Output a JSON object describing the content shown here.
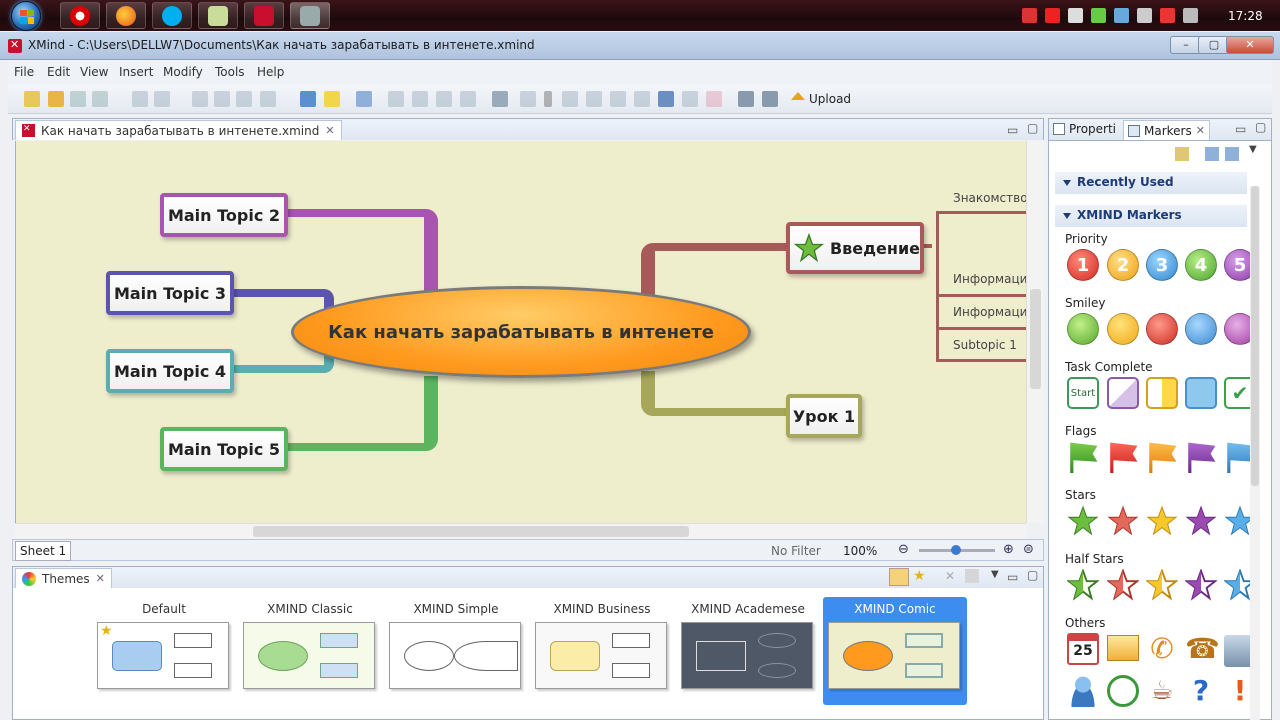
{
  "taskbar": {
    "clock": "17:28",
    "tray_icons": [
      "flag-icon",
      "ati-icon",
      "network-icon",
      "shield-icon",
      "update-icon",
      "volume-icon",
      "warning-icon",
      "usb-icon"
    ]
  },
  "window": {
    "title": "XMind - C:\\Users\\DELLW7\\Documents\\Как начать зарабатывать в интенете.xmind"
  },
  "menu": [
    "File",
    "Edit",
    "View",
    "Insert",
    "Modify",
    "Tools",
    "Help"
  ],
  "toolbar": {
    "upload_label": "Upload"
  },
  "editor": {
    "tab_title": "Как начать зарабатывать в интенете.xmind",
    "central_topic": "Как начать зарабатывать в интенете",
    "topics": {
      "t2": "Main Topic 2",
      "t3": "Main Topic 3",
      "t4": "Main Topic 4",
      "t5": "Main Topic 5",
      "intro": "Введение",
      "lesson": "Урок 1"
    },
    "subtopics": [
      "Знакомство",
      "Информаци",
      "Информаци",
      "Subtopic 1"
    ],
    "sheet_tab": "Sheet 1",
    "filter": "No Filter",
    "zoom": "100%"
  },
  "themes": {
    "panel_title": "Themes",
    "items": [
      {
        "name": "Default",
        "selected": false
      },
      {
        "name": "XMIND Classic",
        "selected": false
      },
      {
        "name": "XMIND Simple",
        "selected": false
      },
      {
        "name": "XMIND Business",
        "selected": false
      },
      {
        "name": "XMIND Academese",
        "selected": false
      },
      {
        "name": "XMIND Comic",
        "selected": true
      }
    ]
  },
  "right_panel": {
    "tabs": [
      "Properti",
      "Markers"
    ],
    "sections": [
      "Recently Used",
      "XMIND Markers"
    ],
    "categories": [
      "Priority",
      "Smiley",
      "Task Complete",
      "Flags",
      "Stars",
      "Half Stars",
      "Others"
    ],
    "priority_values": [
      "1",
      "2",
      "3",
      "4",
      "5"
    ],
    "task_start_label": "Start",
    "others_calendar_day": "25"
  },
  "colors": {
    "accent": "#3d8cf0",
    "branch_purple": "#a755b0",
    "branch_blue": "#5b55b0",
    "branch_teal": "#5aaeb0",
    "branch_green": "#5db45f",
    "branch_red": "#a85a5a",
    "branch_olive": "#a7a75a"
  }
}
